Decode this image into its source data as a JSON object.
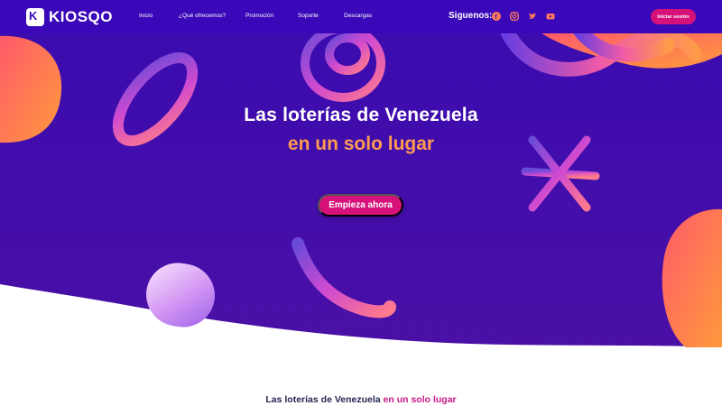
{
  "brand": {
    "logo_mark": "K",
    "name": "KIOSQO"
  },
  "nav": {
    "items": [
      {
        "label": "Inicio"
      },
      {
        "label": "¿Qué ofrecemos?"
      },
      {
        "label": "Promoción"
      },
      {
        "label": "Soporte"
      },
      {
        "label": "Descargas"
      }
    ],
    "follow_label": "Siguenos:",
    "social": [
      "facebook-icon",
      "instagram-icon",
      "twitter-icon",
      "youtube-icon"
    ],
    "login_label": "Iniciar sesión"
  },
  "hero": {
    "title": "Las loterías de Venezuela",
    "subtitle": "en un solo lugar",
    "cta_label": "Empieza ahora"
  },
  "section": {
    "title_main": "Las loterías de Venezuela",
    "title_accent": "en un solo lugar"
  },
  "colors": {
    "nav_bg": "#3a08b8",
    "hero_bg_top": "#3a0bb0",
    "hero_bg_bottom": "#4a0fa8",
    "accent_pink": "#d6127a",
    "accent_orange": "#ff9a52"
  }
}
